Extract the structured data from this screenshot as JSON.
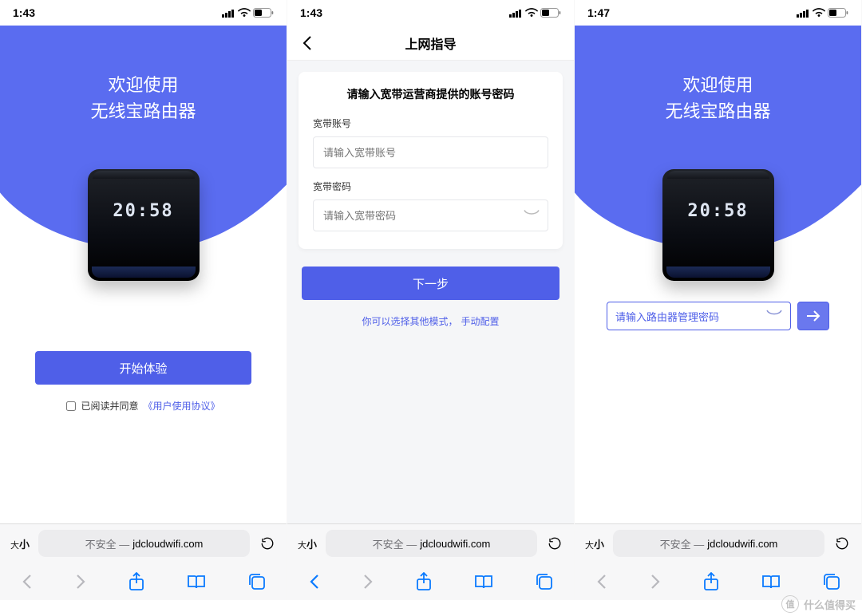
{
  "status": {
    "time1": "1:43",
    "time2": "1:43",
    "time3": "1:47"
  },
  "hero": {
    "title_line1": "欢迎使用",
    "title_line2": "无线宝路由器",
    "device_time": "20:58"
  },
  "screen1": {
    "start_btn": "开始体验",
    "agree_prefix": "已阅读并同意",
    "agree_link": "《用户使用协议》"
  },
  "screen2": {
    "header_title": "上网指导",
    "card_title": "请输入宽带运营商提供的账号密码",
    "acct_label": "宽带账号",
    "acct_ph": "请输入宽带账号",
    "pwd_label": "宽带密码",
    "pwd_ph": "请输入宽带密码",
    "next_btn": "下一步",
    "mode_prefix": "你可以选择其他模式，",
    "mode_link": "手动配置"
  },
  "screen3": {
    "router_pwd_ph": "请输入路由器管理密码"
  },
  "safari": {
    "aa_small": "大",
    "aa_big": "小",
    "insecure": "不安全 —",
    "domain": "jdcloudwifi.com"
  },
  "watermark": {
    "badge": "值",
    "text": "什么值得买"
  }
}
